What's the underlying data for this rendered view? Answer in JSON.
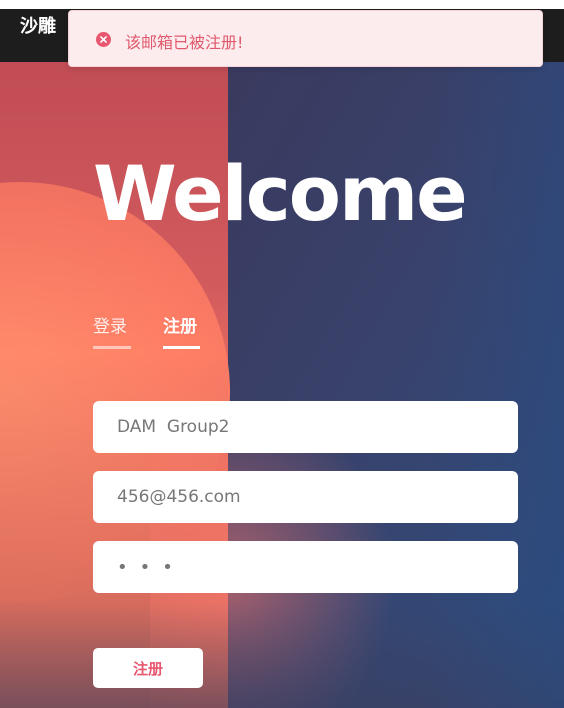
{
  "app": {
    "brand": "沙雕"
  },
  "toast": {
    "icon": "error-circle-icon",
    "message": "该邮箱已被注册!",
    "color": "#e05a6d",
    "background": "#fdecee"
  },
  "hero": {
    "title": "Welcome"
  },
  "tabs": [
    {
      "label": "登录",
      "active": false
    },
    {
      "label": "注册",
      "active": true
    }
  ],
  "form": {
    "username_value": "DAM  Group2",
    "email_value": "456@456.com",
    "password_value": "•••",
    "submit_label": "注册",
    "accent": "#e8566f"
  }
}
